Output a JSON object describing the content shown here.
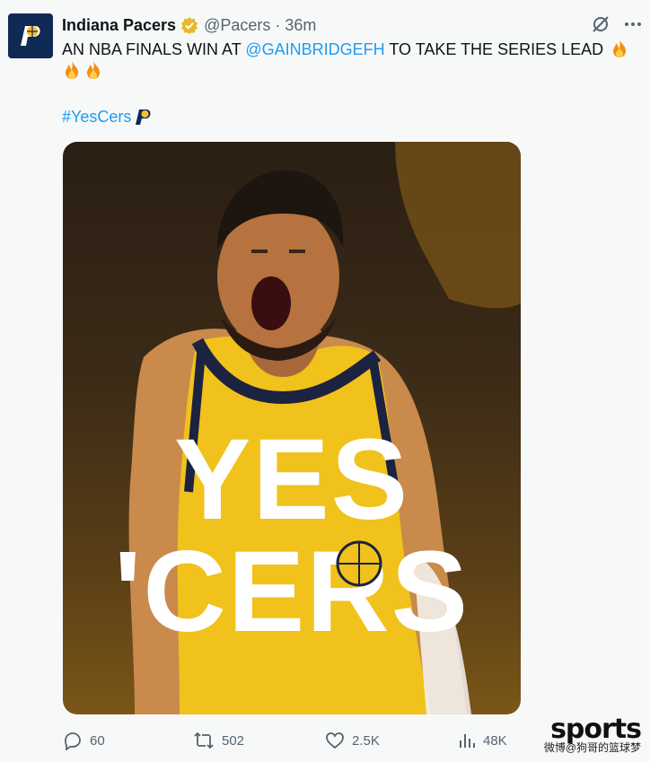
{
  "account": {
    "name": "Indiana Pacers",
    "handle": "@Pacers",
    "separator": "·",
    "time": "36m"
  },
  "tweet": {
    "text_pre": "AN NBA FINALS WIN AT ",
    "mention": "@GAINBRIDGEFH",
    "text_post": " TO TAKE THE SERIES LEAD",
    "hashtag": "#YesCers"
  },
  "media": {
    "headline_line1": "YES",
    "headline_line2": "'CERS"
  },
  "actions": {
    "replies": "60",
    "reposts": "502",
    "likes": "2.5K",
    "views": "48K"
  },
  "watermark": {
    "brand": "sports",
    "sub": "微博@狗哥的篮球梦"
  },
  "colors": {
    "link": "#1d9bf0",
    "secondary_text": "#536471",
    "pacers_navy": "#0f2a54",
    "pacers_gold": "#fdbb30",
    "verified_gold": "#e8b829"
  }
}
